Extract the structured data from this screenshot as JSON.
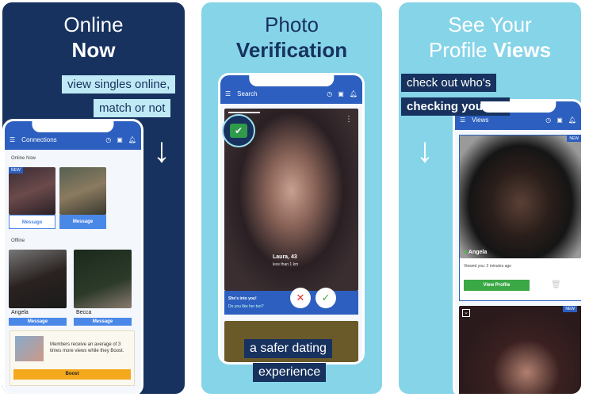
{
  "panels": [
    {
      "title_line1": "Online",
      "title_line2": "Now",
      "tag1": "view singles online,",
      "tag2": "match or not",
      "app": {
        "header": "Connections",
        "section_online": "Online Now",
        "section_offline": "Offline",
        "badge_new": "NEW",
        "message_label": "Message",
        "offline_names": [
          "Angela",
          "Becca"
        ],
        "boost_text": "Members receive an average of 3 times more views while they Boost.",
        "boost_button": "Boost"
      }
    },
    {
      "title_line1": "Photo",
      "title_line2": "Verification",
      "tag1": "a safer dating",
      "tag2": "experience",
      "app": {
        "header": "Search",
        "profile_name": "Laura, 43",
        "distance": "less than 1 km",
        "prompt_title": "She's into you!",
        "prompt_question": "Do you like her too?"
      }
    },
    {
      "title_line1": "See Your",
      "title_line2_a": "Profile ",
      "title_line2_b": "Views",
      "tag1": "check out who's",
      "tag2": "checking you out",
      "app": {
        "header": "Views",
        "badge_new": "NEW",
        "viewer_name": "Angela",
        "viewed_time": "Viewed you: 2 minutes ago",
        "view_profile_button": "View Profile"
      }
    }
  ],
  "colors": {
    "navy": "#17325f",
    "sky": "#86d4e8",
    "app_blue": "#2c5fbf",
    "message_blue": "#4a88e8",
    "green": "#3aa845",
    "boost": "#f4a81c"
  }
}
